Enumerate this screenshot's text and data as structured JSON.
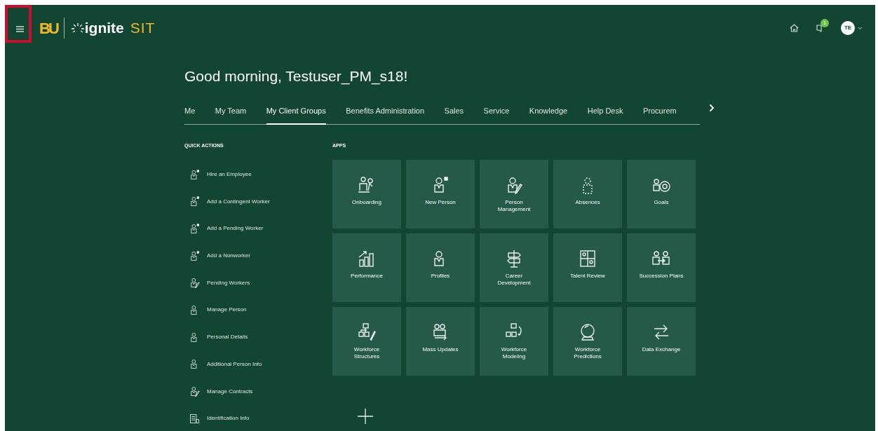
{
  "header": {
    "logo": "BU",
    "brand": "ignite",
    "env": "SIT",
    "notification_count": "1",
    "avatar": "TE"
  },
  "greeting": "Good morning, Testuser_PM_s18!",
  "tabs": [
    {
      "label": "Me",
      "selected": false
    },
    {
      "label": "My Team",
      "selected": false
    },
    {
      "label": "My Client Groups",
      "selected": true
    },
    {
      "label": "Benefits Administration",
      "selected": false
    },
    {
      "label": "Sales",
      "selected": false
    },
    {
      "label": "Service",
      "selected": false
    },
    {
      "label": "Knowledge",
      "selected": false
    },
    {
      "label": "Help Desk",
      "selected": false
    },
    {
      "label": "Procurem",
      "selected": false
    }
  ],
  "quick_actions": {
    "title": "QUICK ACTIONS",
    "items": [
      {
        "label": "Hire an Employee",
        "kind": "add"
      },
      {
        "label": "Add a Contingent Worker",
        "kind": "add"
      },
      {
        "label": "Add a Pending Worker",
        "kind": "add"
      },
      {
        "label": "Add a Nonworker",
        "kind": "add"
      },
      {
        "label": "Pending Workers",
        "kind": "edit"
      },
      {
        "label": "Manage Person",
        "kind": "person"
      },
      {
        "label": "Personal Details",
        "kind": "person"
      },
      {
        "label": "Additional Person Info",
        "kind": "person"
      },
      {
        "label": "Manage Contracts",
        "kind": "edit"
      },
      {
        "label": "Identification Info",
        "kind": "document"
      }
    ]
  },
  "apps": {
    "title": "APPS",
    "items": [
      {
        "label": "Onboarding",
        "kind": "team"
      },
      {
        "label": "New Person",
        "kind": "add"
      },
      {
        "label": "Person Management",
        "kind": "edit"
      },
      {
        "label": "Absences",
        "kind": "absent"
      },
      {
        "label": "Goals",
        "kind": "target"
      },
      {
        "label": "Performance",
        "kind": "chart"
      },
      {
        "label": "Profiles",
        "kind": "person"
      },
      {
        "label": "Career Development",
        "kind": "signpost"
      },
      {
        "label": "Talent Review",
        "kind": "grid"
      },
      {
        "label": "Succession Plans",
        "kind": "swap"
      },
      {
        "label": "Workforce Structures",
        "kind": "org"
      },
      {
        "label": "Mass Updates",
        "kind": "group"
      },
      {
        "label": "Workforce Modeling",
        "kind": "model"
      },
      {
        "label": "Workforce Predictions",
        "kind": "globe"
      },
      {
        "label": "Data Exchange",
        "kind": "arrows"
      }
    ]
  }
}
